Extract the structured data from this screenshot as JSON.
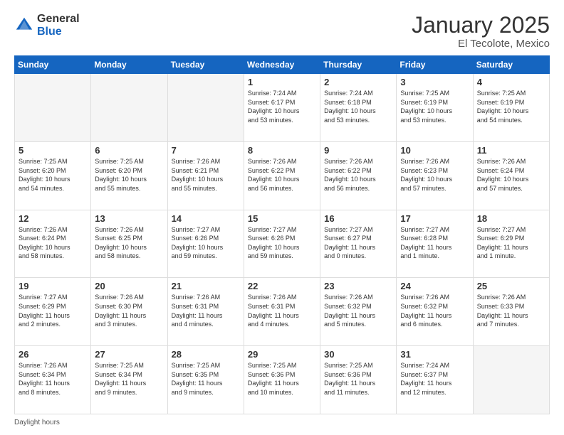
{
  "header": {
    "logo": {
      "general": "General",
      "blue": "Blue"
    },
    "title": "January 2025",
    "subtitle": "El Tecolote, Mexico"
  },
  "weekdays": [
    "Sunday",
    "Monday",
    "Tuesday",
    "Wednesday",
    "Thursday",
    "Friday",
    "Saturday"
  ],
  "weeks": [
    [
      {
        "day": "",
        "info": ""
      },
      {
        "day": "",
        "info": ""
      },
      {
        "day": "",
        "info": ""
      },
      {
        "day": "1",
        "info": "Sunrise: 7:24 AM\nSunset: 6:17 PM\nDaylight: 10 hours\nand 53 minutes."
      },
      {
        "day": "2",
        "info": "Sunrise: 7:24 AM\nSunset: 6:18 PM\nDaylight: 10 hours\nand 53 minutes."
      },
      {
        "day": "3",
        "info": "Sunrise: 7:25 AM\nSunset: 6:19 PM\nDaylight: 10 hours\nand 53 minutes."
      },
      {
        "day": "4",
        "info": "Sunrise: 7:25 AM\nSunset: 6:19 PM\nDaylight: 10 hours\nand 54 minutes."
      }
    ],
    [
      {
        "day": "5",
        "info": "Sunrise: 7:25 AM\nSunset: 6:20 PM\nDaylight: 10 hours\nand 54 minutes."
      },
      {
        "day": "6",
        "info": "Sunrise: 7:25 AM\nSunset: 6:20 PM\nDaylight: 10 hours\nand 55 minutes."
      },
      {
        "day": "7",
        "info": "Sunrise: 7:26 AM\nSunset: 6:21 PM\nDaylight: 10 hours\nand 55 minutes."
      },
      {
        "day": "8",
        "info": "Sunrise: 7:26 AM\nSunset: 6:22 PM\nDaylight: 10 hours\nand 56 minutes."
      },
      {
        "day": "9",
        "info": "Sunrise: 7:26 AM\nSunset: 6:22 PM\nDaylight: 10 hours\nand 56 minutes."
      },
      {
        "day": "10",
        "info": "Sunrise: 7:26 AM\nSunset: 6:23 PM\nDaylight: 10 hours\nand 57 minutes."
      },
      {
        "day": "11",
        "info": "Sunrise: 7:26 AM\nSunset: 6:24 PM\nDaylight: 10 hours\nand 57 minutes."
      }
    ],
    [
      {
        "day": "12",
        "info": "Sunrise: 7:26 AM\nSunset: 6:24 PM\nDaylight: 10 hours\nand 58 minutes."
      },
      {
        "day": "13",
        "info": "Sunrise: 7:26 AM\nSunset: 6:25 PM\nDaylight: 10 hours\nand 58 minutes."
      },
      {
        "day": "14",
        "info": "Sunrise: 7:27 AM\nSunset: 6:26 PM\nDaylight: 10 hours\nand 59 minutes."
      },
      {
        "day": "15",
        "info": "Sunrise: 7:27 AM\nSunset: 6:26 PM\nDaylight: 10 hours\nand 59 minutes."
      },
      {
        "day": "16",
        "info": "Sunrise: 7:27 AM\nSunset: 6:27 PM\nDaylight: 11 hours\nand 0 minutes."
      },
      {
        "day": "17",
        "info": "Sunrise: 7:27 AM\nSunset: 6:28 PM\nDaylight: 11 hours\nand 1 minute."
      },
      {
        "day": "18",
        "info": "Sunrise: 7:27 AM\nSunset: 6:29 PM\nDaylight: 11 hours\nand 1 minute."
      }
    ],
    [
      {
        "day": "19",
        "info": "Sunrise: 7:27 AM\nSunset: 6:29 PM\nDaylight: 11 hours\nand 2 minutes."
      },
      {
        "day": "20",
        "info": "Sunrise: 7:26 AM\nSunset: 6:30 PM\nDaylight: 11 hours\nand 3 minutes."
      },
      {
        "day": "21",
        "info": "Sunrise: 7:26 AM\nSunset: 6:31 PM\nDaylight: 11 hours\nand 4 minutes."
      },
      {
        "day": "22",
        "info": "Sunrise: 7:26 AM\nSunset: 6:31 PM\nDaylight: 11 hours\nand 4 minutes."
      },
      {
        "day": "23",
        "info": "Sunrise: 7:26 AM\nSunset: 6:32 PM\nDaylight: 11 hours\nand 5 minutes."
      },
      {
        "day": "24",
        "info": "Sunrise: 7:26 AM\nSunset: 6:32 PM\nDaylight: 11 hours\nand 6 minutes."
      },
      {
        "day": "25",
        "info": "Sunrise: 7:26 AM\nSunset: 6:33 PM\nDaylight: 11 hours\nand 7 minutes."
      }
    ],
    [
      {
        "day": "26",
        "info": "Sunrise: 7:26 AM\nSunset: 6:34 PM\nDaylight: 11 hours\nand 8 minutes."
      },
      {
        "day": "27",
        "info": "Sunrise: 7:25 AM\nSunset: 6:34 PM\nDaylight: 11 hours\nand 9 minutes."
      },
      {
        "day": "28",
        "info": "Sunrise: 7:25 AM\nSunset: 6:35 PM\nDaylight: 11 hours\nand 9 minutes."
      },
      {
        "day": "29",
        "info": "Sunrise: 7:25 AM\nSunset: 6:36 PM\nDaylight: 11 hours\nand 10 minutes."
      },
      {
        "day": "30",
        "info": "Sunrise: 7:25 AM\nSunset: 6:36 PM\nDaylight: 11 hours\nand 11 minutes."
      },
      {
        "day": "31",
        "info": "Sunrise: 7:24 AM\nSunset: 6:37 PM\nDaylight: 11 hours\nand 12 minutes."
      },
      {
        "day": "",
        "info": ""
      }
    ]
  ],
  "footer": "Daylight hours"
}
